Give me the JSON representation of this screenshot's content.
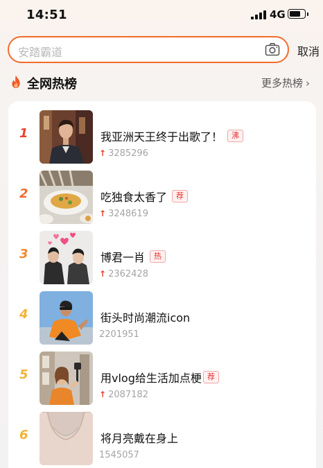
{
  "status_bar": {
    "time": "14:51",
    "network": "4G",
    "battery_level": 0.8
  },
  "search": {
    "placeholder": "安踏霸道",
    "cancel_label": "取消"
  },
  "section": {
    "title": "全网热榜",
    "more_label": "更多热榜"
  },
  "hot_list": [
    {
      "rank": "1",
      "title": "我亚洲天王终于出歌了！",
      "badge": "沸",
      "count": "3285296",
      "trending_up": true,
      "rank_color": "#e8432b"
    },
    {
      "rank": "2",
      "title": "吃独食太香了",
      "badge": "荐",
      "count": "3248619",
      "trending_up": true,
      "rank_color": "#ef6a2c"
    },
    {
      "rank": "3",
      "title": "博君一肖",
      "badge": "热",
      "count": "2362428",
      "trending_up": true,
      "rank_color": "#f08a2e"
    },
    {
      "rank": "4",
      "title": "街头时尚潮流icon",
      "badge": "",
      "count": "2201951",
      "trending_up": false,
      "rank_color": "#f2b23a"
    },
    {
      "rank": "5",
      "title": "用vlog给生活加点梗",
      "badge": "荐",
      "count": "2087182",
      "trending_up": true,
      "rank_color": "#f2b23a"
    },
    {
      "rank": "6",
      "title": "将月亮戴在身上",
      "badge": "",
      "count": "1545057",
      "trending_up": false,
      "rank_color": "#f2b23a"
    }
  ],
  "colors": {
    "accent": "#f26b2c",
    "badge_text": "#e0312f",
    "up_arrow": "#e8432b"
  }
}
